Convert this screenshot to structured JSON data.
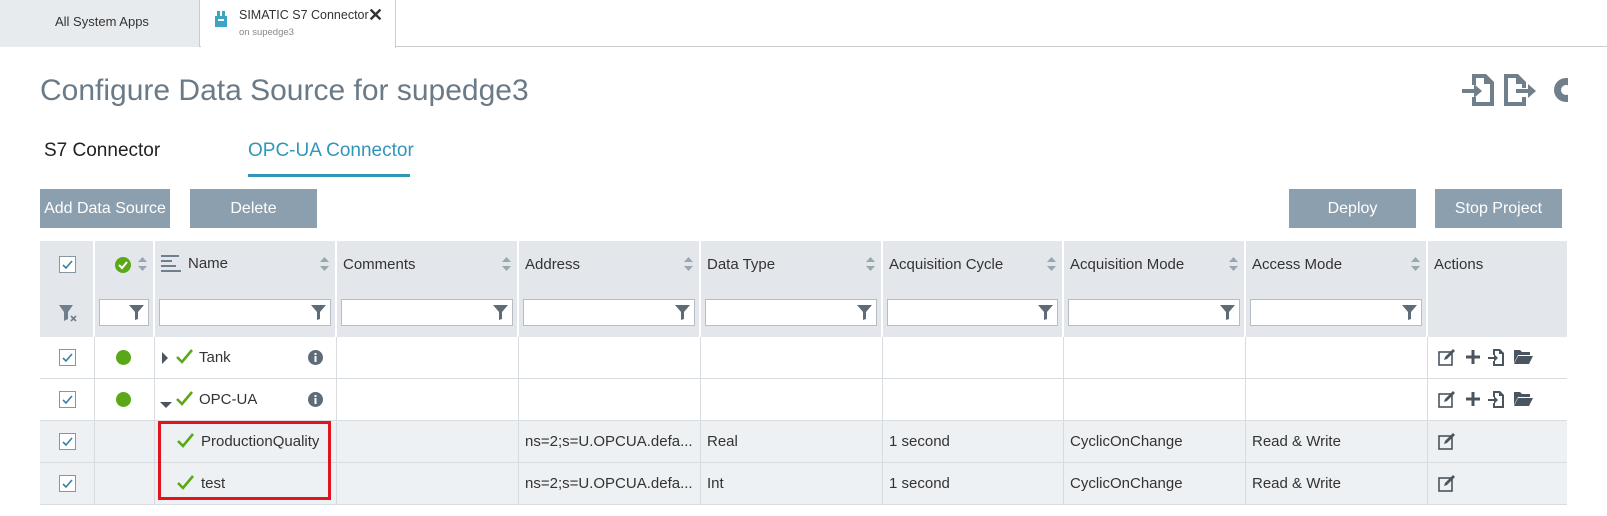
{
  "tabs": {
    "all_apps": "All System Apps",
    "active_title": "SIMATIC S7 Connector",
    "active_subtitle": "on supedge3"
  },
  "page": {
    "title": "Configure Data Source for supedge3"
  },
  "subtabs": {
    "s7": "S7 Connector",
    "opcua": "OPC-UA Connector"
  },
  "toolbar": {
    "add": "Add Data Source",
    "delete": "Delete",
    "deploy": "Deploy",
    "stop": "Stop Project"
  },
  "columns": {
    "name": "Name",
    "comments": "Comments",
    "address": "Address",
    "data_type": "Data Type",
    "acq_cycle": "Acquisition Cycle",
    "acq_mode": "Acquisition Mode",
    "access_mode": "Access Mode",
    "actions": "Actions"
  },
  "rows": [
    {
      "name": "Tank",
      "comments": "",
      "address": "",
      "data_type": "",
      "cycle": "",
      "mode": "",
      "access": ""
    },
    {
      "name": "OPC-UA",
      "comments": "",
      "address": "",
      "data_type": "",
      "cycle": "",
      "mode": "",
      "access": ""
    },
    {
      "name": "ProductionQuality",
      "comments": "",
      "address": "ns=2;s=U.OPCUA.defa...",
      "data_type": "Real",
      "cycle": "1 second",
      "mode": "CyclicOnChange",
      "access": "Read & Write"
    },
    {
      "name": "test",
      "comments": "",
      "address": "ns=2;s=U.OPCUA.defa...",
      "data_type": "Int",
      "cycle": "1 second",
      "mode": "CyclicOnChange",
      "access": "Read & Write"
    }
  ],
  "colors": {
    "accent": "#3296b9",
    "button": "#8c9fae",
    "status_ok": "#5aa818",
    "highlight": "#e0141e"
  }
}
